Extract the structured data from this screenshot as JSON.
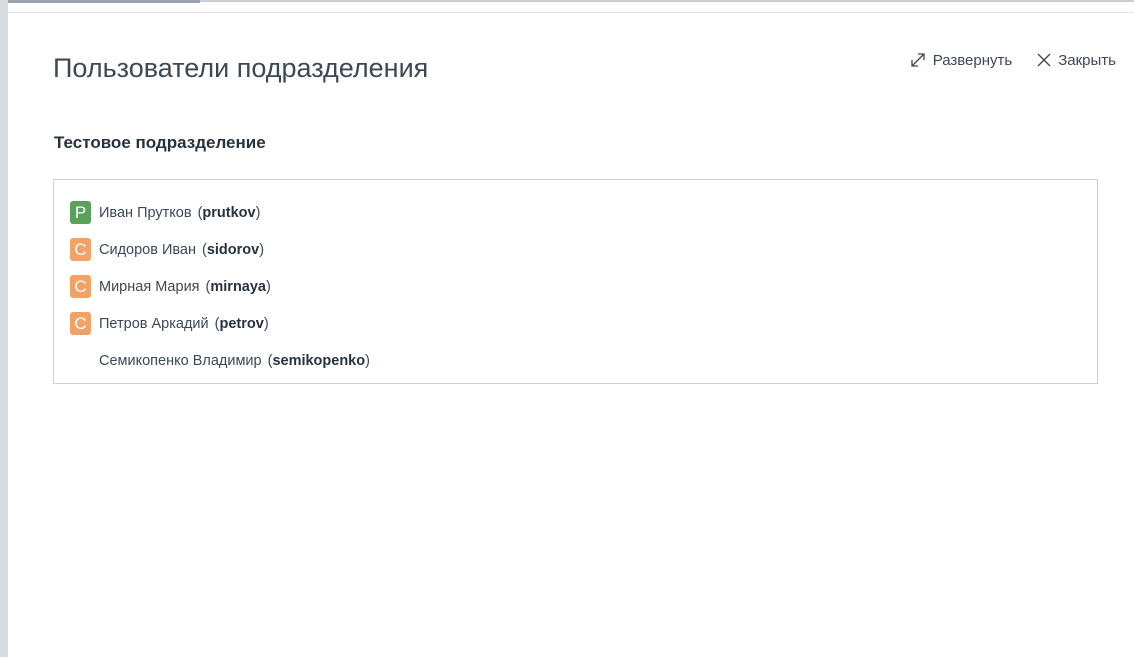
{
  "dialog": {
    "title": "Пользователи подразделения",
    "expand_label": "Развернуть",
    "close_label": "Закрыть"
  },
  "group": {
    "title": "Тестовое подразделение"
  },
  "users": [
    {
      "name": "Иван Прутков",
      "login": "prutkov",
      "badge": "Р",
      "badge_color": "#5aa15e"
    },
    {
      "name": "Сидоров Иван",
      "login": "sidorov",
      "badge": "С",
      "badge_color": "#f2a265"
    },
    {
      "name": "Мирная Мария",
      "login": "mirnaya",
      "badge": "С",
      "badge_color": "#f2a265"
    },
    {
      "name": "Петров Аркадий",
      "login": "petrov",
      "badge": "С",
      "badge_color": "#f2a265"
    },
    {
      "name": "Семикопенко Владимир",
      "login": "semikopenko",
      "badge": "",
      "badge_color": ""
    }
  ],
  "icons": {
    "expand": "expand-arrows-icon",
    "close": "close-icon"
  }
}
